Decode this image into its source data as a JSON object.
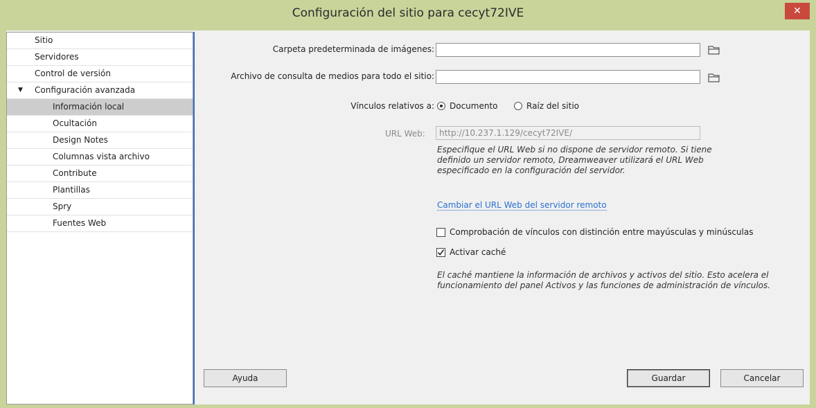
{
  "window": {
    "title": "Configuración del sitio para cecyt72IVE",
    "close_glyph": "✕"
  },
  "sidebar": {
    "items": [
      {
        "label": "Sitio",
        "level": 0,
        "selected": false
      },
      {
        "label": "Servidores",
        "level": 0,
        "selected": false
      },
      {
        "label": "Control de versión",
        "level": 0,
        "selected": false
      },
      {
        "label": "Configuración avanzada",
        "level": 0,
        "selected": false,
        "expanded": true,
        "arrow": "▼"
      },
      {
        "label": "Información local",
        "level": 1,
        "selected": true
      },
      {
        "label": "Ocultación",
        "level": 1,
        "selected": false
      },
      {
        "label": "Design Notes",
        "level": 1,
        "selected": false
      },
      {
        "label": "Columnas vista archivo",
        "level": 1,
        "selected": false
      },
      {
        "label": "Contribute",
        "level": 1,
        "selected": false
      },
      {
        "label": "Plantillas",
        "level": 1,
        "selected": false
      },
      {
        "label": "Spry",
        "level": 1,
        "selected": false
      },
      {
        "label": "Fuentes Web",
        "level": 1,
        "selected": false
      }
    ]
  },
  "form": {
    "images_folder_label": "Carpeta predeterminada de imágenes:",
    "images_folder_value": "",
    "media_query_label": "Archivo de consulta de medios para todo el sitio:",
    "media_query_value": "",
    "relative_links_label": "Vínculos relativos a:",
    "relative_option_document": "Documento",
    "relative_option_root": "Raíz del sitio",
    "relative_selected": "document",
    "web_url_label": "URL Web:",
    "web_url_value": "http://10.237.1.129/cecyt72IVE/",
    "web_url_note": "Especifique el URL Web si no dispone de servidor remoto. Si tiene definido un servidor remoto, Dreamweaver utilizará el URL Web especificado en la configuración del servidor.",
    "change_url_link": "Cambiar el URL Web del servidor remoto",
    "case_sensitive_label": "Comprobación de vínculos con distinción entre mayúsculas y minúsculas",
    "case_sensitive_checked": false,
    "cache_label": "Activar caché",
    "cache_checked": true,
    "cache_note": "El caché mantiene la información de archivos y activos del sitio. Esto acelera el funcionamiento del panel Activos y las funciones de administración de vínculos."
  },
  "buttons": {
    "help": "Ayuda",
    "save": "Guardar",
    "cancel": "Cancelar"
  },
  "icons": {
    "browse": "folder-icon",
    "close": "close-icon",
    "expand": "triangle-down-icon",
    "check": "checkmark-icon"
  }
}
